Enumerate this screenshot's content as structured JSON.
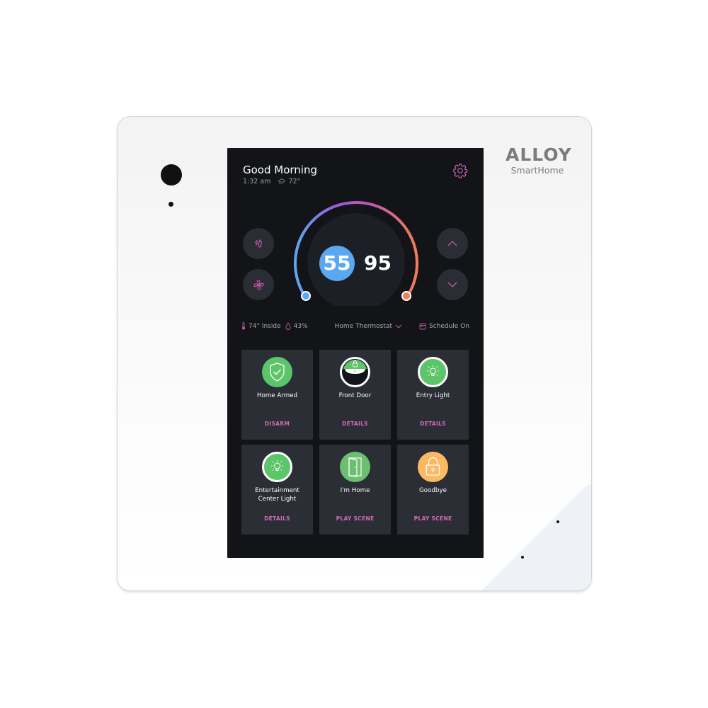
{
  "device": {
    "brand_name": "ALLOY",
    "brand_sub": "SmartHome"
  },
  "header": {
    "greeting": "Good Morning",
    "time": "1:32 am",
    "weather_icon": "cloud-rain-icon",
    "outdoor_temp": "72°",
    "settings_icon": "gear-icon"
  },
  "thermostat": {
    "heat_setpoint": "55",
    "cool_setpoint": "95",
    "mode_buttons": [
      {
        "name": "mode-button",
        "icon": "heat-cool-mode-icon"
      },
      {
        "name": "fan-button",
        "icon": "fan-icon"
      }
    ],
    "adjust_buttons": [
      {
        "name": "increase-button",
        "icon": "chevron-up-icon"
      },
      {
        "name": "decrease-button",
        "icon": "chevron-down-icon"
      }
    ],
    "colors": {
      "heat": "#5aa9f0",
      "cool": "#f27d5a",
      "arc_mid": "#a55ad6",
      "accent": "#d06ab8"
    }
  },
  "status_bar": {
    "inside_temp": "74° Inside",
    "humidity": "43%",
    "thermostat_selector": "Home Thermostat",
    "schedule": "Schedule On"
  },
  "tiles": [
    {
      "label": "Home Armed",
      "action": "DISARM",
      "icon": "shield-check-icon",
      "color": "#5cc469"
    },
    {
      "label": "Front Door",
      "action": "DETAILS",
      "icon": "door-lock-icon",
      "color": "#5cc469"
    },
    {
      "label": "Entry Light",
      "action": "DETAILS",
      "icon": "light-bulb-icon",
      "color": "#5cc469"
    },
    {
      "label": "Entertainment Center Light",
      "action": "DETAILS",
      "icon": "light-bulb-icon",
      "color": "#5cc469"
    },
    {
      "label": "I'm Home",
      "action": "PLAY SCENE",
      "icon": "door-open-icon",
      "color": "#6cbf6f"
    },
    {
      "label": "Goodbye",
      "action": "PLAY SCENE",
      "icon": "padlock-icon",
      "color": "#fbb964"
    }
  ]
}
